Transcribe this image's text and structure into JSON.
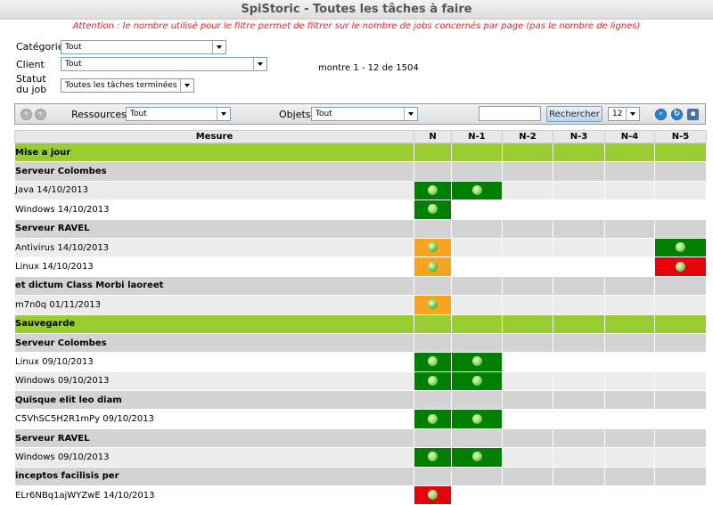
{
  "title": "SpiStoric - Toutes les tâches à faire",
  "warning": "Attention : le nombre utilisé pour le filtre permet de filtrer sur le nombre de jobs concernés par page (pas le nombre de lignes)",
  "filters": {
    "categorie": {
      "label": "Catégorie",
      "value": "Tout"
    },
    "client": {
      "label": "Client",
      "value": "Tout"
    },
    "statut": {
      "label": "Statut du job",
      "value": "Toutes les tâches terminées"
    }
  },
  "range_text": "montre 1 - 12 de 1504",
  "toolbar": {
    "ressources_label": "Ressources",
    "ressources_value": "Tout",
    "objets_label": "Objets",
    "objets_value": "Tout",
    "search_value": "",
    "search_button": "Rechercher",
    "page_size": "12"
  },
  "colors": {
    "ok": "#008000",
    "warn": "#f7a421",
    "error": "#e8000d",
    "category": "#9acd32",
    "group": "#d3d3d3"
  },
  "table": {
    "columns": [
      "Mesure",
      "N",
      "N-1",
      "N-2",
      "N-3",
      "N-4",
      "N-5"
    ],
    "rows": [
      {
        "type": "category",
        "label": "Mise a jour"
      },
      {
        "type": "group",
        "label": "Serveur Colombes"
      },
      {
        "type": "job",
        "label": "Java 14/10/2013",
        "status": [
          "ok",
          "ok",
          "",
          "",
          "",
          ""
        ]
      },
      {
        "type": "job",
        "label": "Windows 14/10/2013",
        "status": [
          "ok",
          "",
          "",
          "",
          "",
          ""
        ]
      },
      {
        "type": "group",
        "label": "Serveur RAVEL"
      },
      {
        "type": "job",
        "label": "Antivirus 14/10/2013",
        "status": [
          "warn",
          "",
          "",
          "",
          "",
          "ok"
        ]
      },
      {
        "type": "job",
        "label": "Linux 14/10/2013",
        "status": [
          "warn",
          "",
          "",
          "",
          "",
          "error"
        ]
      },
      {
        "type": "group",
        "label": "et dictum Class Morbi laoreet"
      },
      {
        "type": "job",
        "label": "m7n0q 01/11/2013",
        "status": [
          "warn",
          "",
          "",
          "",
          "",
          ""
        ]
      },
      {
        "type": "category",
        "label": "Sauvegarde"
      },
      {
        "type": "group",
        "label": "Serveur Colombes"
      },
      {
        "type": "job",
        "label": "Linux 09/10/2013",
        "status": [
          "ok",
          "ok",
          "",
          "",
          "",
          ""
        ]
      },
      {
        "type": "job",
        "label": "Windows 09/10/2013",
        "status": [
          "ok",
          "ok",
          "",
          "",
          "",
          ""
        ]
      },
      {
        "type": "group",
        "label": "Quisque elit leo diam"
      },
      {
        "type": "job",
        "label": "C5VhSC5H2R1mPy 09/10/2013",
        "status": [
          "ok",
          "ok",
          "",
          "",
          "",
          ""
        ]
      },
      {
        "type": "group",
        "label": "Serveur RAVEL"
      },
      {
        "type": "job",
        "label": "Windows 09/10/2013",
        "status": [
          "ok",
          "ok",
          "",
          "",
          "",
          ""
        ]
      },
      {
        "type": "group",
        "label": "inceptos facilisis per"
      },
      {
        "type": "job",
        "label": "ELr6NBq1ajWYZwE 14/10/2013",
        "status": [
          "error",
          "",
          "",
          "",
          "",
          ""
        ]
      }
    ]
  }
}
